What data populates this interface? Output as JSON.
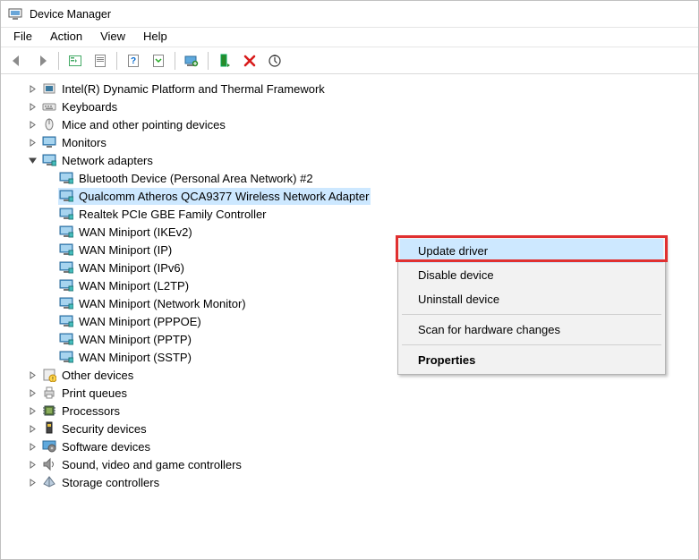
{
  "window": {
    "title": "Device Manager"
  },
  "menu": {
    "file": "File",
    "action": "Action",
    "view": "View",
    "help": "Help"
  },
  "context": {
    "update": "Update driver",
    "disable": "Disable device",
    "uninstall": "Uninstall device",
    "scan": "Scan for hardware changes",
    "properties": "Properties"
  },
  "tree": {
    "cat_intel": "Intel(R) Dynamic Platform and Thermal Framework",
    "cat_keyboards": "Keyboards",
    "cat_mice": "Mice and other pointing devices",
    "cat_monitors": "Monitors",
    "cat_network": "Network adapters",
    "na_bt": "Bluetooth Device (Personal Area Network) #2",
    "na_qca": "Qualcomm Atheros QCA9377 Wireless Network Adapter",
    "na_realtek": "Realtek PCIe GBE Family Controller",
    "na_ikev2": "WAN Miniport (IKEv2)",
    "na_ip": "WAN Miniport (IP)",
    "na_ipv6": "WAN Miniport (IPv6)",
    "na_l2tp": "WAN Miniport (L2TP)",
    "na_netmon": "WAN Miniport (Network Monitor)",
    "na_pppoe": "WAN Miniport (PPPOE)",
    "na_pptp": "WAN Miniport (PPTP)",
    "na_sstp": "WAN Miniport (SSTP)",
    "cat_other": "Other devices",
    "cat_printq": "Print queues",
    "cat_proc": "Processors",
    "cat_sec": "Security devices",
    "cat_soft": "Software devices",
    "cat_sound": "Sound, video and game controllers",
    "cat_storage": "Storage controllers"
  }
}
